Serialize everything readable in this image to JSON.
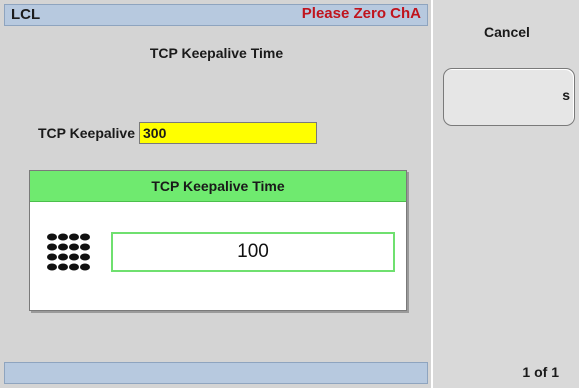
{
  "status_bar": {
    "mode": "LCL",
    "message": "Please Zero ChA",
    "message_color": "#c0141d"
  },
  "page": {
    "title": "TCP Keepalive Time"
  },
  "field": {
    "label": "TCP Keepalive",
    "value": "300",
    "highlight_color": "#ffff00"
  },
  "dialog": {
    "title": "TCP Keepalive Time",
    "header_color": "#6fea6f",
    "input_value": "100",
    "icon": "keypad-icon"
  },
  "softkeys": {
    "cancel_label": "Cancel",
    "s_label": "s",
    "page_indicator": "1 of 1"
  }
}
